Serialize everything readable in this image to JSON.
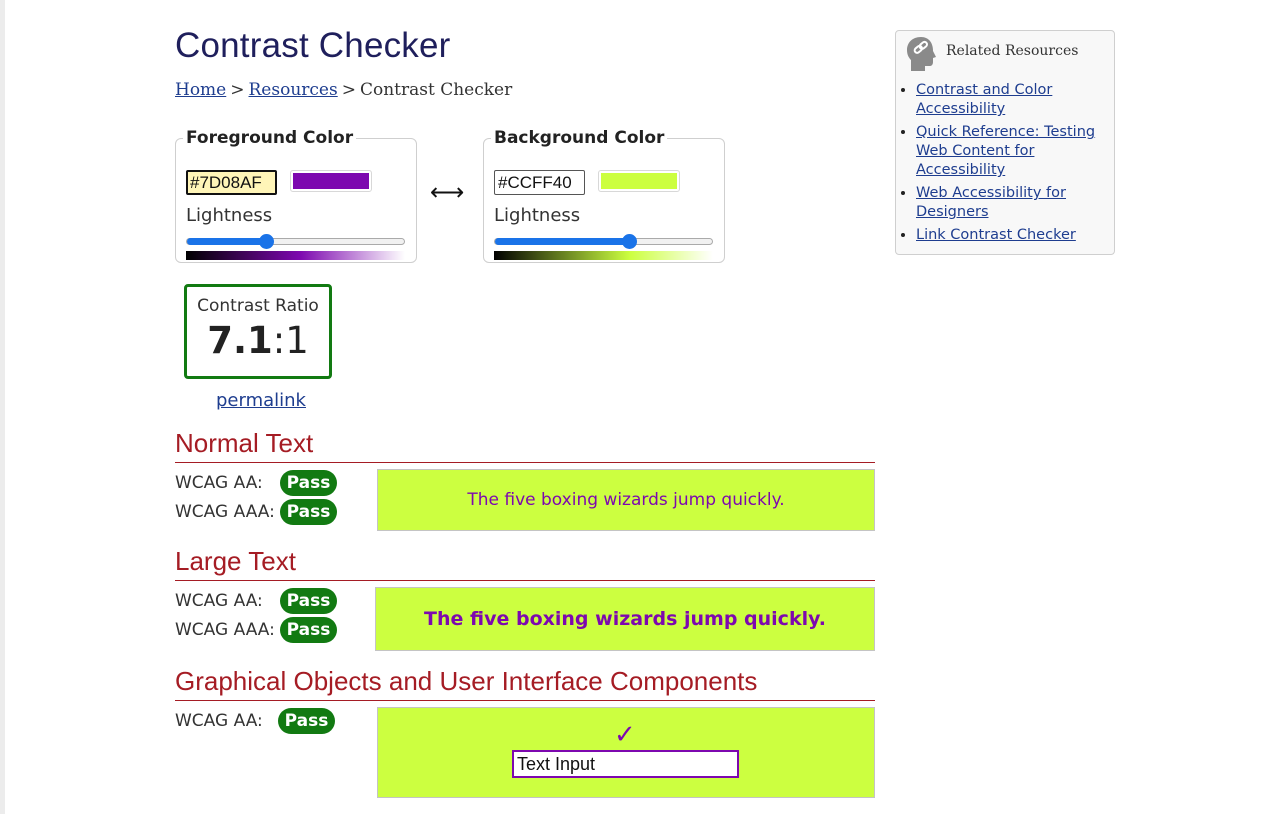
{
  "page": {
    "title": "Contrast Checker",
    "breadcrumb": {
      "home": "Home",
      "resources": "Resources",
      "current": "Contrast Checker",
      "separator": ">"
    }
  },
  "foreground": {
    "legend": "Foreground Color",
    "hex_value": "#7D08AF",
    "swatch_color": "#7D08AF",
    "lightness_label": "Lightness",
    "lightness_fraction": 0.37
  },
  "background": {
    "legend": "Background Color",
    "hex_value": "#CCFF40",
    "swatch_color": "#CCFF40",
    "lightness_label": "Lightness",
    "lightness_fraction": 0.62
  },
  "swap": {
    "icon": "left-right-arrow-icon",
    "glyph": "⟷"
  },
  "contrast": {
    "label": "Contrast Ratio",
    "ratio": "7.1",
    "suffix": ":1",
    "permalink": "permalink",
    "border_color": "#127a12"
  },
  "sections": {
    "normal": {
      "title": "Normal Text",
      "aa_label": "WCAG AA:",
      "aa_result": "Pass",
      "aaa_label": "WCAG AAA:",
      "aaa_result": "Pass",
      "sample": "The five boxing wizards jump quickly."
    },
    "large": {
      "title": "Large Text",
      "aa_label": "WCAG AA:",
      "aa_result": "Pass",
      "aaa_label": "WCAG AAA:",
      "aaa_result": "Pass",
      "sample": "The five boxing wizards jump quickly."
    },
    "graphical": {
      "title": "Graphical Objects and User Interface Components",
      "aa_label": "WCAG AA:",
      "aa_result": "Pass",
      "check_glyph": "✓",
      "input_value": "Text Input"
    }
  },
  "colors": {
    "accent_red": "#a51c24",
    "pass_green": "#127a12",
    "title_navy": "#1f1f5c",
    "link_blue": "#1e3d8f"
  },
  "related": {
    "title": "Related Resources",
    "icon": "link-head-icon",
    "links": [
      "Contrast and Color Accessibility",
      "Quick Reference: Testing Web Content for Accessibility",
      "Web Accessibility for Designers",
      "Link Contrast Checker"
    ]
  }
}
